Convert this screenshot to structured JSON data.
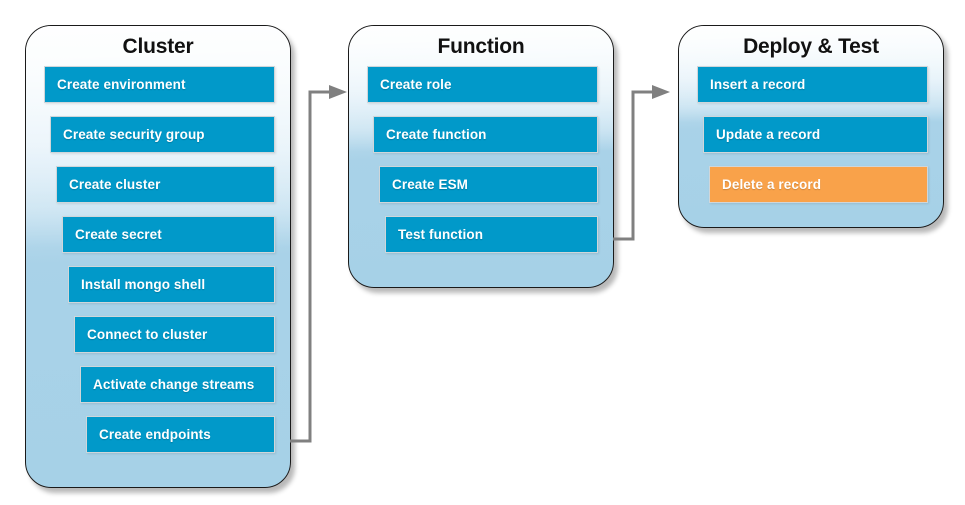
{
  "diagram": {
    "title": "Cluster / Function / Deploy & Test workflow",
    "colors": {
      "step_blue": "#0199c9",
      "step_orange": "#f9a24a",
      "container_top": "#f4fafd",
      "container_bottom": "#a6d1e7",
      "connector_gray": "#808080",
      "label_white": "#ffffff",
      "title_black": "#111111"
    },
    "phases": [
      {
        "id": "cluster",
        "title": "Cluster",
        "steps": [
          {
            "label": "Create environment",
            "highlight": false
          },
          {
            "label": "Create security group",
            "highlight": false
          },
          {
            "label": "Create cluster",
            "highlight": false
          },
          {
            "label": "Create secret",
            "highlight": false
          },
          {
            "label": "Install mongo shell",
            "highlight": false
          },
          {
            "label": "Connect to cluster",
            "highlight": false
          },
          {
            "label": "Activate change streams",
            "highlight": false
          },
          {
            "label": "Create endpoints",
            "highlight": false
          }
        ]
      },
      {
        "id": "function",
        "title": "Function",
        "steps": [
          {
            "label": "Create role",
            "highlight": false
          },
          {
            "label": "Create function",
            "highlight": false
          },
          {
            "label": "Create ESM",
            "highlight": false
          },
          {
            "label": "Test function",
            "highlight": false
          }
        ]
      },
      {
        "id": "deploy-test",
        "title": "Deploy & Test",
        "steps": [
          {
            "label": "Insert a record",
            "highlight": false
          },
          {
            "label": "Update a record",
            "highlight": false
          },
          {
            "label": "Delete a record",
            "highlight": true
          }
        ]
      }
    ],
    "connectors": [
      {
        "id": "cluster-to-function",
        "from": "Create endpoints",
        "to": "Create role"
      },
      {
        "id": "function-to-deploy",
        "from": "Test function",
        "to": "Insert a record"
      }
    ]
  }
}
